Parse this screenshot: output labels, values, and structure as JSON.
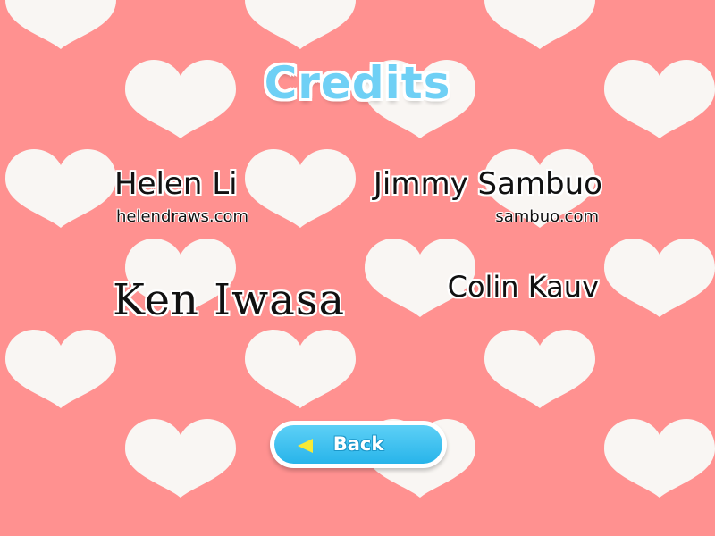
{
  "title": "Credits",
  "credits": [
    {
      "name": "Helen Li",
      "site": "helendraws.com"
    },
    {
      "name": "Jimmy Sambuo",
      "site": "sambuo.com"
    },
    {
      "name": "Ken Iwasa"
    },
    {
      "name": "Colin Kauv"
    }
  ],
  "back_button": {
    "label": "Back",
    "icon": "left-arrow-icon"
  },
  "colors": {
    "background": "#ff9190",
    "heart": "#f9f6f3",
    "title": "#6fd0f5",
    "button": "#28b4ea",
    "arrow": "#f7ea36"
  }
}
